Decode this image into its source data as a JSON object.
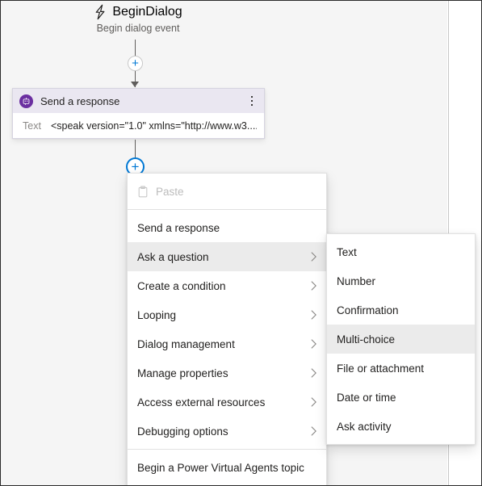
{
  "canvas": {
    "trigger": {
      "icon": "lightning-bolt-icon",
      "title": "BeginDialog",
      "subtitle": "Begin dialog event"
    },
    "add_node_buttons": [
      {
        "name": "add-node-button-top",
        "glyph": "+",
        "state": "idle"
      },
      {
        "name": "add-node-button-active",
        "glyph": "+",
        "state": "active"
      }
    ],
    "action_card": {
      "icon": "bot-response-icon",
      "title": "Send a response",
      "menu_icon": "more-options-icon",
      "field_label": "Text",
      "field_value": "<speak version=\"1.0\" xmlns=\"http://www.w3...."
    }
  },
  "context_menu": {
    "items": [
      {
        "label": "Paste",
        "icon": "clipboard-icon",
        "disabled": true,
        "submenu": false,
        "highlight": false,
        "separator_after": true
      },
      {
        "label": "Send a response",
        "icon": null,
        "disabled": false,
        "submenu": false,
        "highlight": false,
        "separator_after": false
      },
      {
        "label": "Ask a question",
        "icon": null,
        "disabled": false,
        "submenu": true,
        "highlight": true,
        "separator_after": false
      },
      {
        "label": "Create a condition",
        "icon": null,
        "disabled": false,
        "submenu": true,
        "highlight": false,
        "separator_after": false
      },
      {
        "label": "Looping",
        "icon": null,
        "disabled": false,
        "submenu": true,
        "highlight": false,
        "separator_after": false
      },
      {
        "label": "Dialog management",
        "icon": null,
        "disabled": false,
        "submenu": true,
        "highlight": false,
        "separator_after": false
      },
      {
        "label": "Manage properties",
        "icon": null,
        "disabled": false,
        "submenu": true,
        "highlight": false,
        "separator_after": false
      },
      {
        "label": "Access external resources",
        "icon": null,
        "disabled": false,
        "submenu": true,
        "highlight": false,
        "separator_after": false
      },
      {
        "label": "Debugging options",
        "icon": null,
        "disabled": false,
        "submenu": true,
        "highlight": false,
        "separator_after": true
      },
      {
        "label": "Begin a Power Virtual Agents topic",
        "icon": null,
        "disabled": false,
        "submenu": false,
        "highlight": false,
        "separator_after": false
      }
    ]
  },
  "submenu": {
    "parent": "Ask a question",
    "items": [
      {
        "label": "Text",
        "highlight": false
      },
      {
        "label": "Number",
        "highlight": false
      },
      {
        "label": "Confirmation",
        "highlight": false
      },
      {
        "label": "Multi-choice",
        "highlight": true
      },
      {
        "label": "File or attachment",
        "highlight": false
      },
      {
        "label": "Date or time",
        "highlight": false
      },
      {
        "label": "Ask activity",
        "highlight": false
      }
    ]
  },
  "colors": {
    "canvas_background": "#f5f5f5",
    "card_header": "#eae7f1",
    "bot_icon": "#6b2fa0",
    "accent_blue": "#0078d4",
    "menu_highlight": "#ebebeb",
    "text_primary": "#201f1e",
    "text_secondary": "#605e5c",
    "text_disabled": "#bcbcbc"
  }
}
